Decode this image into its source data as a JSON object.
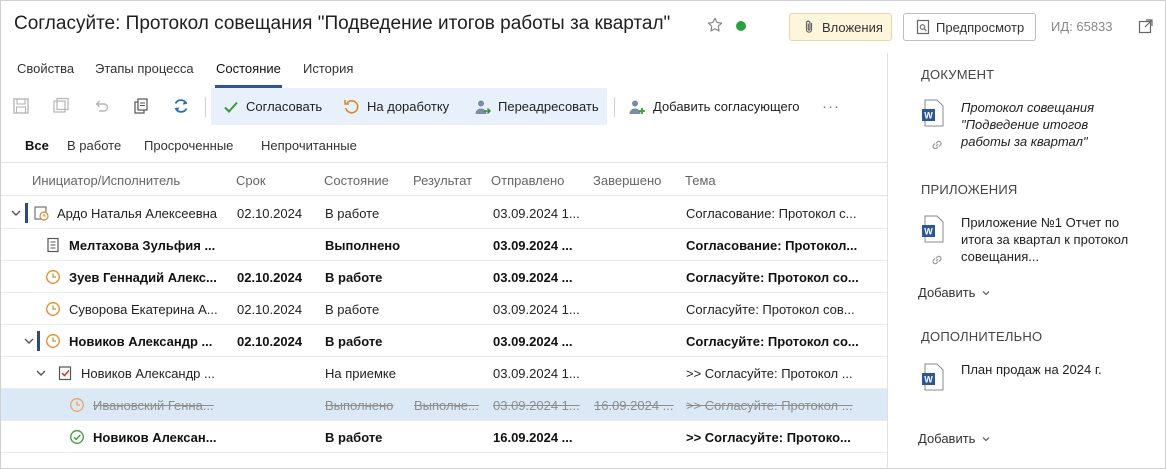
{
  "header": {
    "title": "Согласуйте: Протокол совещания \"Подведение итогов работы за квартал\"",
    "attachments_label": "Вложения",
    "preview_label": "Предпросмотр",
    "doc_id": "ИД: 65833"
  },
  "tabs": [
    {
      "label": "Свойства"
    },
    {
      "label": "Этапы процесса"
    },
    {
      "label": "Состояние"
    },
    {
      "label": "История"
    }
  ],
  "toolbar": {
    "approve_label": "Согласовать",
    "rework_label": "На доработку",
    "redirect_label": "Переадресовать",
    "add_approver_label": "Добавить согласующего",
    "more_label": "···"
  },
  "filters": [
    {
      "label": "Все"
    },
    {
      "label": "В работе"
    },
    {
      "label": "Просроченные"
    },
    {
      "label": "Непрочитанные"
    }
  ],
  "table": {
    "columns": [
      "Инициатор/Исполнитель",
      "Срок",
      "Состояние",
      "Результат",
      "Отправлено",
      "Завершено",
      "Тема"
    ],
    "rows": [
      {
        "name": "Ардо Наталья Алексеевна",
        "due": "02.10.2024",
        "state": "В работе",
        "result": "",
        "sent": "03.09.2024 1...",
        "done": "",
        "subject": "Согласование: Протокол с..."
      },
      {
        "name": "Мелтахова Зульфия ...",
        "due": "",
        "state": "Выполнено",
        "result": "",
        "sent": "03.09.2024 ...",
        "done": "",
        "subject": "Согласование: Протокол..."
      },
      {
        "name": "Зуев Геннадий Алекс...",
        "due": "02.10.2024",
        "state": "В работе",
        "result": "",
        "sent": "03.09.2024 ...",
        "done": "",
        "subject": "Согласуйте: Протокол со..."
      },
      {
        "name": "Суворова Екатерина А...",
        "due": "02.10.2024",
        "state": "В работе",
        "result": "",
        "sent": "03.09.2024 1...",
        "done": "",
        "subject": "Согласуйте: Протокол сов..."
      },
      {
        "name": "Новиков Александр ...",
        "due": "02.10.2024",
        "state": "В работе",
        "result": "",
        "sent": "03.09.2024 ...",
        "done": "",
        "subject": "Согласуйте: Протокол со..."
      },
      {
        "name": "Новиков Александр ...",
        "due": "",
        "state": "На приемке",
        "result": "",
        "sent": "03.09.2024 1...",
        "done": "",
        "subject": ">> Согласуйте: Протокол ..."
      },
      {
        "name": "Ивановский Генна...",
        "due": "",
        "state": "Выполнено",
        "result": "Выполне...",
        "sent": "03.09.2024 1...",
        "done": "16.09.2024 ...",
        "subject": ">> Согласуйте: Протокол ..."
      },
      {
        "name": "Новиков Алексан...",
        "due": "",
        "state": "В работе",
        "result": "",
        "sent": "16.09.2024 ...",
        "done": "",
        "subject": ">> Согласуйте: Протоко..."
      }
    ]
  },
  "panel": {
    "document_title": "ДОКУМЕНТ",
    "document_name": "Протокол совещания \"Подведение итогов работы за квартал\"",
    "attachments_title": "ПРИЛОЖЕНИЯ",
    "attachment_name": "Приложение №1 Отчет по итога за квартал к протокол совещания...",
    "add_label_1": "Добавить",
    "additional_title": "ДОПОЛНИТЕЛЬНО",
    "additional_name": "План продаж на 2024 г.",
    "add_label_2": "Добавить"
  },
  "colors": {
    "accent": "#2f5597",
    "status_green": "#2ea043",
    "clock_orange": "#e08a2c",
    "selected_row": "#dbe8f5",
    "toolbar_group": "#e8f1fb",
    "word_blue": "#2b5797"
  }
}
